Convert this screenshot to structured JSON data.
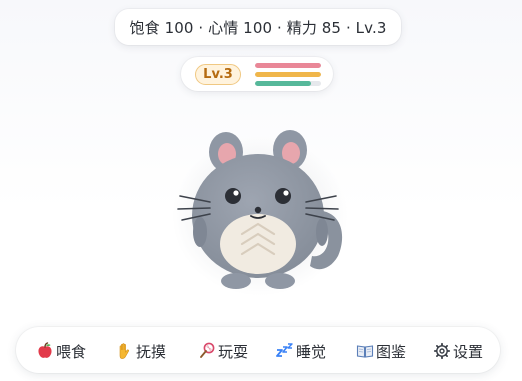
{
  "status": {
    "text": "饱食 100 · 心情 100 · 精力 85 · Lv.3",
    "level_label": "Lv.3",
    "food": 100,
    "mood": 100,
    "energy": 85
  },
  "colors": {
    "food_bar": "#e98797",
    "mood_bar": "#f0b64a",
    "energy_bar": "#56b89a",
    "pet_fur": "#8f97a4",
    "pet_belly": "#f1ebe1",
    "ear_inner": "#e7a6ad"
  },
  "actions": [
    {
      "id": "feed",
      "label": "喂食",
      "icon": "apple-icon"
    },
    {
      "id": "pet",
      "label": "抚摸",
      "icon": "hand-icon"
    },
    {
      "id": "play",
      "label": "玩耍",
      "icon": "badminton-icon"
    },
    {
      "id": "sleep",
      "label": "睡觉",
      "icon": "zzz-icon"
    },
    {
      "id": "collection",
      "label": "图鉴",
      "icon": "book-icon"
    },
    {
      "id": "settings",
      "label": "设置",
      "icon": "gear-icon"
    }
  ]
}
